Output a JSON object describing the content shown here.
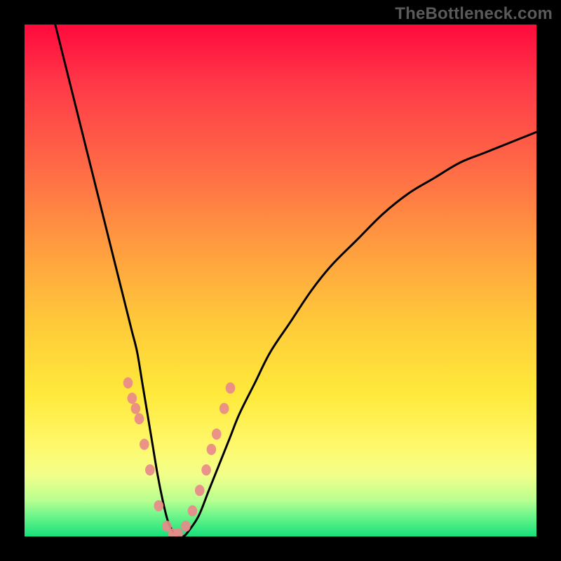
{
  "watermark": "TheBottleneck.com",
  "chart_data": {
    "type": "line",
    "title": "",
    "xlabel": "",
    "ylabel": "",
    "xlim": [
      0,
      100
    ],
    "ylim": [
      0,
      100
    ],
    "series": [
      {
        "name": "bottleneck-curve",
        "x": [
          6,
          8,
          10,
          12,
          14,
          16,
          18,
          20,
          21,
          22,
          23,
          24,
          25,
          26,
          27,
          28,
          29,
          30,
          31,
          32,
          34,
          36,
          38,
          40,
          42,
          45,
          48,
          52,
          56,
          60,
          65,
          70,
          75,
          80,
          85,
          90,
          95,
          100
        ],
        "y": [
          100,
          92,
          84,
          76,
          68,
          60,
          52,
          44,
          40,
          36,
          30,
          24,
          18,
          12,
          7,
          3,
          1,
          0,
          0,
          1,
          4,
          9,
          14,
          19,
          24,
          30,
          36,
          42,
          48,
          53,
          58,
          63,
          67,
          70,
          73,
          75,
          77,
          79
        ]
      }
    ],
    "markers": {
      "name": "highlight-points",
      "color": "#e98a8a",
      "x": [
        20.2,
        21.0,
        21.7,
        22.4,
        23.4,
        24.5,
        26.2,
        27.8,
        29.0,
        30.0,
        31.5,
        32.8,
        34.2,
        35.5,
        36.5,
        37.5,
        39.0,
        40.2
      ],
      "y": [
        30,
        27,
        25,
        23,
        18,
        13,
        6,
        2,
        0.5,
        0.5,
        2,
        5,
        9,
        13,
        17,
        20,
        25,
        29
      ]
    },
    "gradient_stops": [
      {
        "pos": 0,
        "color": "#ff0a3c"
      },
      {
        "pos": 12,
        "color": "#ff3a48"
      },
      {
        "pos": 28,
        "color": "#ff6a46"
      },
      {
        "pos": 42,
        "color": "#ff9840"
      },
      {
        "pos": 58,
        "color": "#ffc93a"
      },
      {
        "pos": 72,
        "color": "#ffe93a"
      },
      {
        "pos": 82,
        "color": "#fff86a"
      },
      {
        "pos": 88,
        "color": "#f2ff8a"
      },
      {
        "pos": 93,
        "color": "#b8ff90"
      },
      {
        "pos": 96,
        "color": "#6cf58a"
      },
      {
        "pos": 100,
        "color": "#17e07a"
      }
    ]
  },
  "curve_stroke": "#000000",
  "curve_width": 3,
  "marker_radius": 8
}
